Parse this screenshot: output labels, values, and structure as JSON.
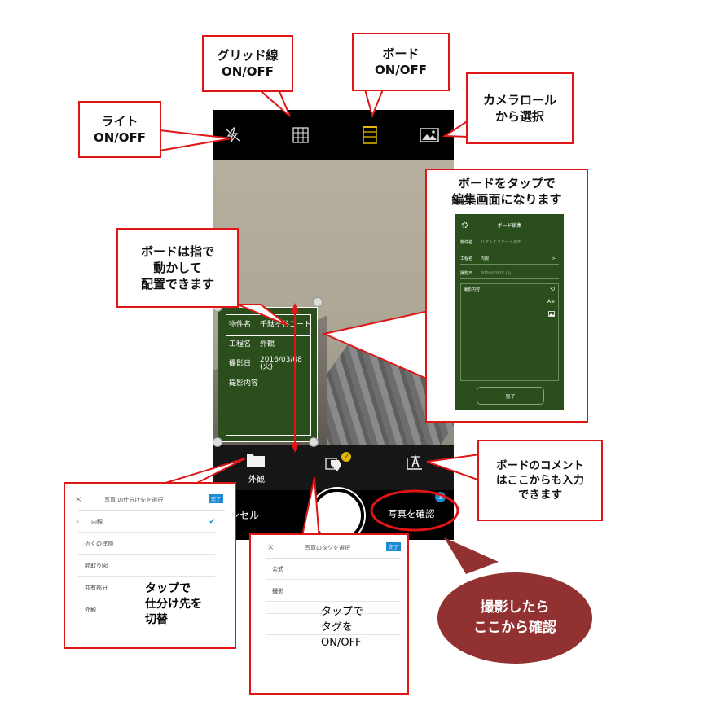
{
  "phone": {
    "top_icons": [
      "flash-off-icon",
      "grid-icon",
      "board-icon",
      "camera-roll-icon"
    ],
    "board": {
      "rows": [
        {
          "label": "物件名",
          "value": "千駄ヶ谷コート"
        },
        {
          "label": "工程名",
          "value": "外観"
        },
        {
          "label": "撮影日",
          "value": "2016/03/08 (火)"
        },
        {
          "label": "撮影内容",
          "value": ""
        }
      ]
    },
    "toolbar": {
      "folder_label": "外観",
      "tag_badge": "2"
    },
    "bottom": {
      "cancel_label": "ンセル",
      "confirm_label": "写真を確認",
      "confirm_badge": "3"
    }
  },
  "callouts": {
    "light": "ライト\nON/OFF",
    "grid": "グリッド線\nON/OFF",
    "board": "ボード\nON/OFF",
    "camera_roll": "カメラロール\nから選択",
    "board_edit": "ボードをタップで\n編集画面になります",
    "board_move": "ボードは指で\n動かして\n配置できます",
    "comment": "ボードのコメント\nはここからも入力\nできます",
    "confirm": "撮影したら\nここから確認"
  },
  "board_edit_preview": {
    "title": "ボード編集",
    "rows": [
      {
        "label": "物件名",
        "value": "リアルエステート赤田"
      },
      {
        "label": "工程名",
        "value": "内観",
        "chevron": ">"
      },
      {
        "label": "撮影日",
        "value": "2016/03/15 (火)"
      }
    ],
    "content_label": "撮影内容",
    "side_icons": [
      "history-icon",
      "text-size-icon",
      "image-icon"
    ],
    "done_label": "完了"
  },
  "sort_panel": {
    "close": "×",
    "title": "写真 の仕分け先を選択",
    "done": "完了",
    "items": [
      "内観",
      "近くの建物",
      "間取り図",
      "共有部分",
      "外観"
    ],
    "selected_index": 0,
    "note": "タップで\n仕分け先を\n切替"
  },
  "tag_panel": {
    "close": "×",
    "title": "写真のタグを選択",
    "done": "完了",
    "items": [
      "公式",
      "撮影"
    ],
    "note": "タップで\nタグを\nON/OFF"
  },
  "colors": {
    "callout_border": "#e01616",
    "board_green": "#2a4f1c",
    "accent_blue": "#1d8bd1",
    "board_icon_yellow": "#e2b800",
    "confirm_bubble": "#913131"
  }
}
